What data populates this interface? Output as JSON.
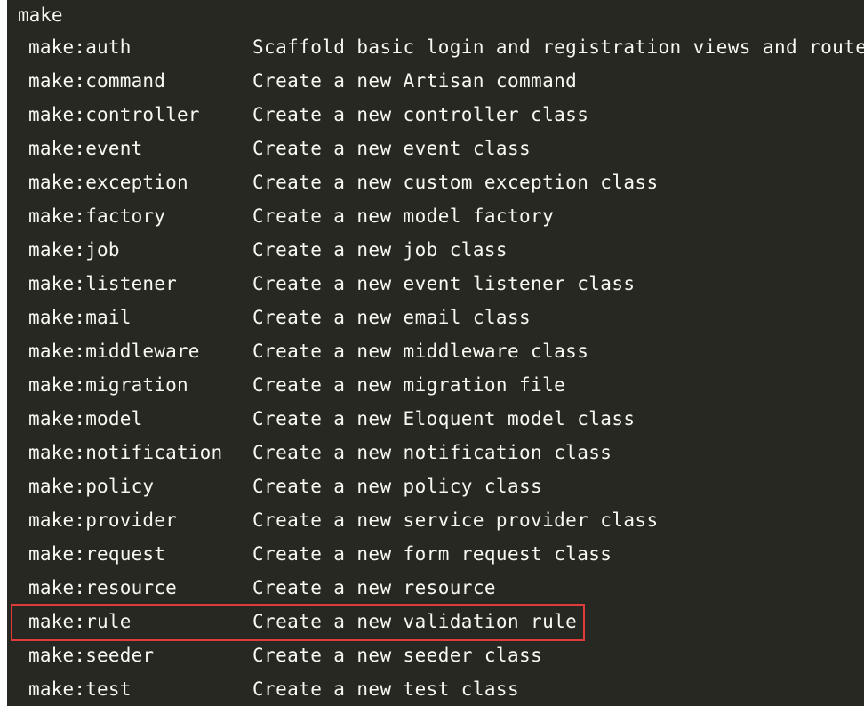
{
  "group_title": "make",
  "highlight_color": "#e03c3c",
  "background_color": "#272822",
  "text_color": "#f8f8f2",
  "commands": [
    {
      "name": "make:auth",
      "description": "Scaffold basic login and registration views and routes",
      "highlighted": false
    },
    {
      "name": "make:command",
      "description": "Create a new Artisan command",
      "highlighted": false
    },
    {
      "name": "make:controller",
      "description": "Create a new controller class",
      "highlighted": false
    },
    {
      "name": "make:event",
      "description": "Create a new event class",
      "highlighted": false
    },
    {
      "name": "make:exception",
      "description": "Create a new custom exception class",
      "highlighted": false
    },
    {
      "name": "make:factory",
      "description": "Create a new model factory",
      "highlighted": false
    },
    {
      "name": "make:job",
      "description": "Create a new job class",
      "highlighted": false
    },
    {
      "name": "make:listener",
      "description": "Create a new event listener class",
      "highlighted": false
    },
    {
      "name": "make:mail",
      "description": "Create a new email class",
      "highlighted": false
    },
    {
      "name": "make:middleware",
      "description": "Create a new middleware class",
      "highlighted": false
    },
    {
      "name": "make:migration",
      "description": "Create a new migration file",
      "highlighted": false
    },
    {
      "name": "make:model",
      "description": "Create a new Eloquent model class",
      "highlighted": false
    },
    {
      "name": "make:notification",
      "description": "Create a new notification class",
      "highlighted": false
    },
    {
      "name": "make:policy",
      "description": "Create a new policy class",
      "highlighted": false
    },
    {
      "name": "make:provider",
      "description": "Create a new service provider class",
      "highlighted": false
    },
    {
      "name": "make:request",
      "description": "Create a new form request class",
      "highlighted": false
    },
    {
      "name": "make:resource",
      "description": "Create a new resource",
      "highlighted": false
    },
    {
      "name": "make:rule",
      "description": "Create a new validation rule",
      "highlighted": true
    },
    {
      "name": "make:seeder",
      "description": "Create a new seeder class",
      "highlighted": false
    },
    {
      "name": "make:test",
      "description": "Create a new test class",
      "highlighted": false
    }
  ]
}
